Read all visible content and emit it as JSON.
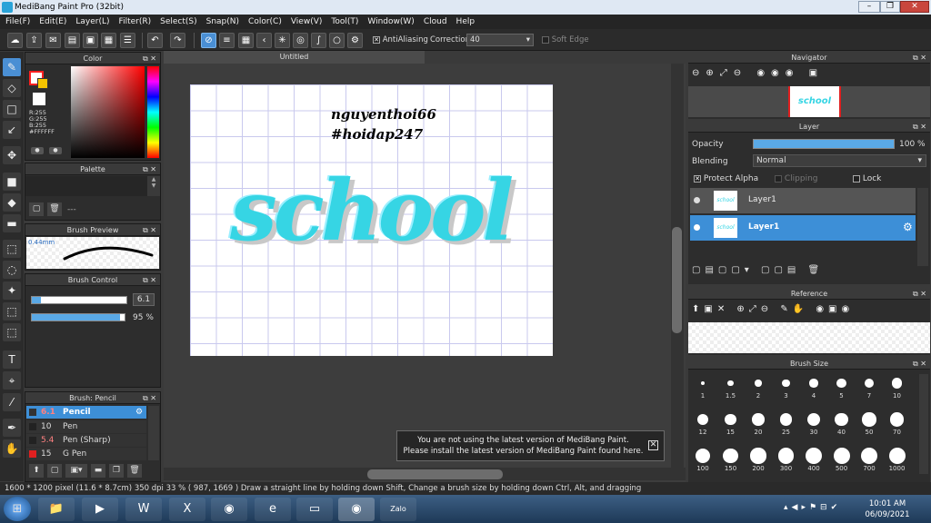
{
  "window": {
    "title": "MediBang Paint Pro (32bit)"
  },
  "menu": [
    "File(F)",
    "Edit(E)",
    "Layer(L)",
    "Filter(R)",
    "Select(S)",
    "Snap(N)",
    "Color(C)",
    "View(V)",
    "Tool(T)",
    "Window(W)",
    "Cloud",
    "Help"
  ],
  "toolbar": {
    "antialias_label": "AntiAliasing",
    "correction_label": "Correction",
    "correction_value": "40",
    "softedge_label": "Soft Edge"
  },
  "color_panel": {
    "title": "Color",
    "r": "R:255",
    "g": "G:255",
    "b": "B:255",
    "hex": "#FFFFFF",
    "accent": "#ff0000"
  },
  "palette": {
    "title": "Palette",
    "dash": "---"
  },
  "brush_preview": {
    "title": "Brush Preview",
    "size": "0.44mm"
  },
  "brush_control": {
    "title": "Brush Control",
    "size_value": "6.1",
    "opacity_value": "95 %",
    "size_fill": 0.1,
    "opacity_fill": 0.95
  },
  "brush_list": {
    "title": "Brush: Pencil",
    "items": [
      {
        "size": "6.1",
        "name": "Pencil",
        "color": "#333333"
      },
      {
        "size": "10",
        "name": "Pen",
        "color": "#333333"
      },
      {
        "size": "5.4",
        "name": "Pen (Sharp)",
        "color": "#333333"
      },
      {
        "size": "15",
        "name": "G Pen",
        "color": "#e02020"
      }
    ]
  },
  "document": {
    "tab": "Untitled",
    "sig_line1": "nguyenthoi66",
    "sig_line2": "#hoidap247",
    "word": "school"
  },
  "notice": {
    "line1": "You are not using the latest version of MediBang Paint.",
    "line2": "Please install the latest version of MediBang Paint found here.",
    "close": "✕"
  },
  "navigator": {
    "title": "Navigator",
    "thumb": "school"
  },
  "layer_panel": {
    "title": "Layer",
    "opacity_label": "Opacity",
    "opacity_value": "100 %",
    "opacity_fill": 1.0,
    "blending_label": "Blending",
    "blending_value": "Normal",
    "protect_alpha": "Protect Alpha",
    "clipping": "Clipping",
    "lock": "Lock",
    "layers": [
      {
        "name": "Layer1",
        "thumb": "school"
      },
      {
        "name": "Layer1",
        "thumb": "school"
      }
    ]
  },
  "reference": {
    "title": "Reference"
  },
  "brush_size": {
    "title": "Brush Size",
    "sizes": [
      "1",
      "1.5",
      "2",
      "3",
      "4",
      "5",
      "7",
      "10",
      "12",
      "15",
      "20",
      "25",
      "30",
      "40",
      "50",
      "70",
      "100",
      "150",
      "200",
      "300",
      "400",
      "500",
      "700",
      "1000"
    ]
  },
  "status": "1600 * 1200 pixel   (11.6 * 8.7cm)   350 dpi   33 %   ( 987, 1669 )   Draw a straight line by holding down Shift, Change a brush size by holding down Ctrl, Alt, and dragging",
  "taskbar": {
    "time": "10:01 AM",
    "date": "06/09/2021",
    "zalo": "Zalo"
  }
}
